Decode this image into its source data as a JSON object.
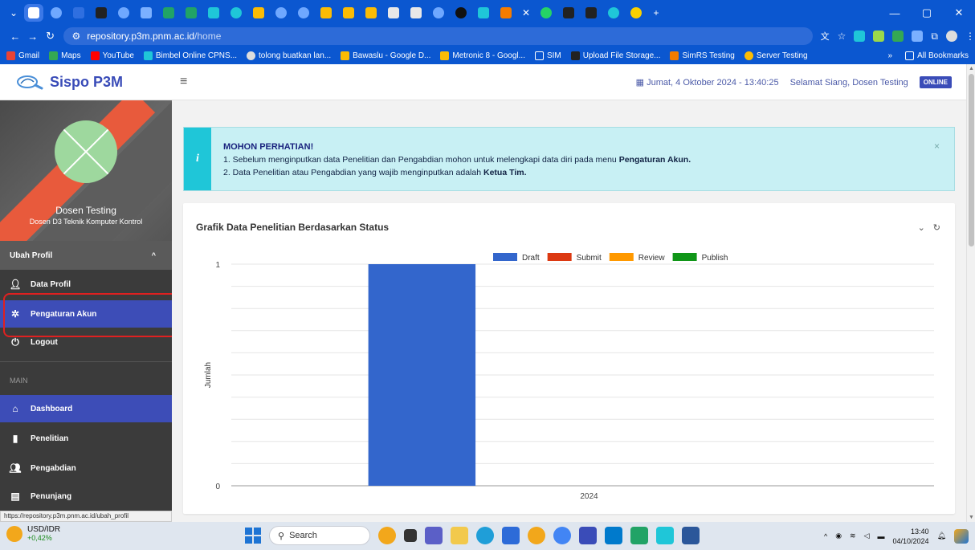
{
  "browser": {
    "url_host": "repository.p3m.pnm.ac.id",
    "url_path": "/home",
    "window_controls": [
      "—",
      "▢",
      "✕"
    ],
    "bookmarks": [
      {
        "label": "Gmail",
        "color": "#ea4335"
      },
      {
        "label": "Maps",
        "color": "#34a853"
      },
      {
        "label": "YouTube",
        "color": "#ff0000"
      },
      {
        "label": "Bimbel Online CPNS...",
        "color": "#1fc6d8"
      },
      {
        "label": "tolong buatkan lan...",
        "color": "#dddddd"
      },
      {
        "label": "Bawaslu - Google D...",
        "color": "#fbbc04"
      },
      {
        "label": "Metronic 8 - Googl...",
        "color": "#fbbc04"
      },
      {
        "label": "SIM",
        "color": "#0b57d0"
      },
      {
        "label": "Upload File Storage...",
        "color": "#222222"
      },
      {
        "label": "SimRS Testing",
        "color": "#f57c00"
      },
      {
        "label": "Server Testing",
        "color": "#fbbc04"
      }
    ],
    "bookmarks_more": "»",
    "all_bookmarks": "All Bookmarks"
  },
  "app": {
    "brand": "Sispo P3M",
    "datetime": "Jumat, 4 Oktober 2024 - 13:40:25",
    "greeting": "Selamat Siang, Dosen Testing",
    "status_badge": "ONLINE",
    "accent": "#3d4db7"
  },
  "sidebar": {
    "profile_name": "Dosen Testing",
    "profile_dept": "Dosen D3 Teknik Komputer Kontrol",
    "ubah_profil": "Ubah Profil",
    "profile_menu": [
      {
        "label": "Data Profil",
        "icon": "user-plus-icon"
      },
      {
        "label": "Pengaturan Akun",
        "icon": "gear-icon"
      },
      {
        "label": "Logout",
        "icon": "power-icon"
      }
    ],
    "section_label": "MAIN",
    "main_menu": [
      {
        "label": "Dashboard",
        "icon": "home-icon"
      },
      {
        "label": "Penelitian",
        "icon": "book-icon"
      },
      {
        "label": "Pengabdian",
        "icon": "people-icon"
      },
      {
        "label": "Penunjang",
        "icon": "clipboard-icon"
      }
    ]
  },
  "alert": {
    "title": "MOHON PERHATIAN!",
    "line1_text": "1. Sebelum menginputkan data Penelitian dan Pengabdian mohon untuk melengkapi data diri pada menu ",
    "line1_bold": "Pengaturan Akun.",
    "line2_text": "2. Data Penelitian atau Pengabdian yang wajib menginputkan adalah ",
    "line2_bold": "Ketua Tim.",
    "close": "×"
  },
  "card": {
    "title": "Grafik Data Penelitian Berdasarkan Status",
    "tool_collapse": "⌄",
    "tool_refresh": "↻"
  },
  "chart_data": {
    "type": "bar",
    "categories": [
      "2024"
    ],
    "series": [
      {
        "name": "Draft",
        "values": [
          1
        ],
        "color": "#3366cc"
      },
      {
        "name": "Submit",
        "values": [
          0
        ],
        "color": "#dc3912"
      },
      {
        "name": "Review",
        "values": [
          0
        ],
        "color": "#ff9900"
      },
      {
        "name": "Publish",
        "values": [
          0
        ],
        "color": "#109618"
      }
    ],
    "ylabel": "Jumlah",
    "ylim": [
      0,
      1
    ],
    "yticks": [
      "0",
      "1"
    ],
    "grid": true,
    "legend": "top"
  },
  "status_url": "https://repository.p3m.pnm.ac.id/ubah_profil",
  "taskbar": {
    "ticker_symbol": "USD/IDR",
    "ticker_change": "+0,42%",
    "search_label": "Search",
    "time": "13:40",
    "date": "04/10/2024"
  }
}
